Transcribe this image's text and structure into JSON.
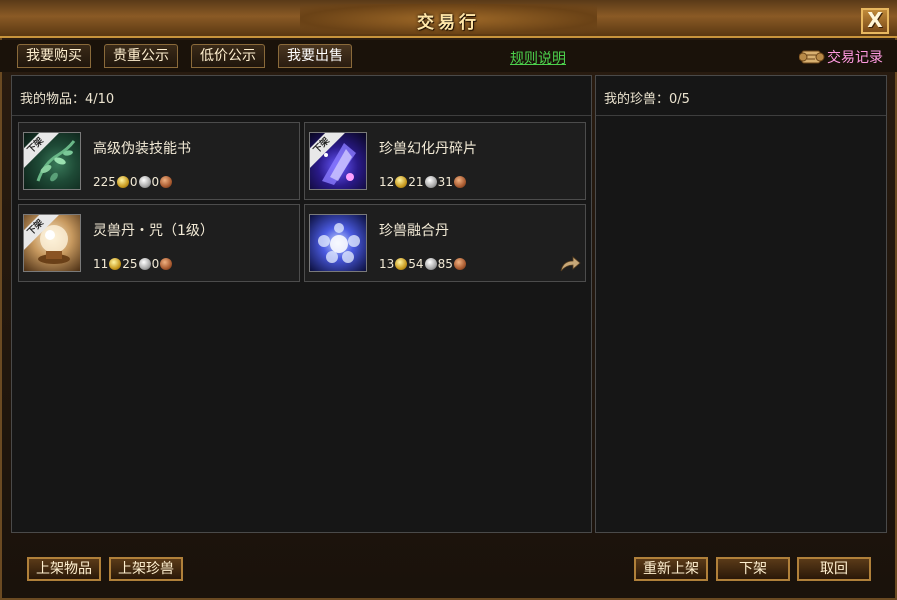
{
  "window": {
    "title": "交易行",
    "close_label": "X"
  },
  "tabs": [
    {
      "label": "我要购买"
    },
    {
      "label": "贵重公示"
    },
    {
      "label": "低价公示"
    },
    {
      "label": "我要出售"
    }
  ],
  "rules_link": "规则说明",
  "trade_record": {
    "label": "交易记录",
    "icon": "scroll-icon"
  },
  "left_panel": {
    "header": "我的物品：4/10"
  },
  "right_panel": {
    "header": "我的珍兽：0/5"
  },
  "items": [
    {
      "name": "高级伪装技能书",
      "badge": "下架",
      "gold": "225",
      "silver": "0",
      "copper": "0",
      "icon": "skill-book-icon"
    },
    {
      "name": "珍兽幻化丹碎片",
      "badge": "下架",
      "gold": "12",
      "silver": "21",
      "copper": "31",
      "icon": "crystal-shard-icon"
    },
    {
      "name": "灵兽丹・咒（1级）",
      "badge": "下架",
      "gold": "11",
      "silver": "25",
      "copper": "0",
      "icon": "orb-pedestal-icon"
    },
    {
      "name": "珍兽融合丹",
      "badge": "",
      "gold": "13",
      "silver": "54",
      "copper": "85",
      "icon": "fusion-pill-icon"
    }
  ],
  "bottom_buttons": {
    "list_item": "上架物品",
    "list_pet": "上架珍兽",
    "relist": "重新上架",
    "delist": "下架",
    "cancel": "取回"
  },
  "colors": {
    "rules_link": "#4cd04c",
    "trade_record": "#ff9ae0",
    "border": "#b0803a"
  }
}
